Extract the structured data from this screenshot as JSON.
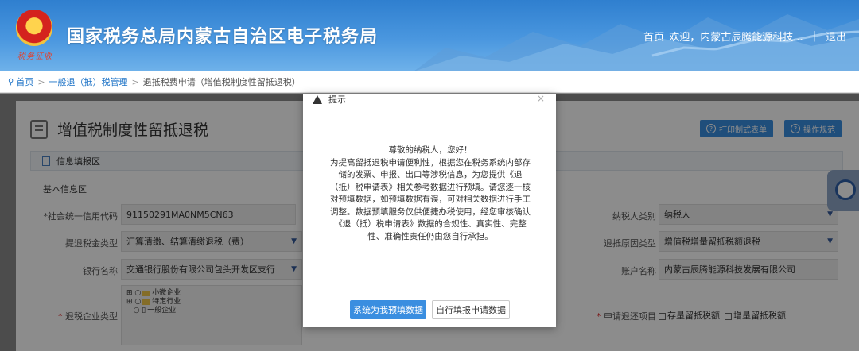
{
  "header": {
    "emblem_script": "税务征收",
    "title": "国家税务总局内蒙古自治区电子税务局",
    "nav": {
      "home": "首页",
      "welcome": "欢迎，内蒙古辰腾能源科技...",
      "separator": "|",
      "logout": "退出"
    }
  },
  "breadcrumb": {
    "home": "首页",
    "level1": "一般退（抵）税管理",
    "current": "退抵税费申请（增值税制度性留抵退税）"
  },
  "page": {
    "title": "增值税制度性留抵退税",
    "btn_print": "打印制式表单",
    "btn_guide": "操作规范",
    "section": "信息填报区",
    "subsection": "基本信息区"
  },
  "form": {
    "credit_code_label": "*社会统一信用代码",
    "credit_code_value": "91150291MA0NM5CN63",
    "taxpayer_type_label": "纳税人类别",
    "taxpayer_type_value": "纳税人",
    "refund_tax_type_label": "提退税金类型",
    "refund_tax_type_value": "汇算清缴、结算清缴退税（费）",
    "refund_reason_label": "退抵原因类型",
    "refund_reason_value": "增值税增量留抵税额退税",
    "bank_label": "银行名称",
    "bank_value": "交通银行股份有限公司包头开发区支行",
    "account_name_label": "账户名称",
    "account_name_value": "内蒙古辰腾能源科技发展有限公司",
    "enterprise_type_label": "退税企业类型",
    "enterprise_type_tree": [
      "小微企业",
      "特定行业",
      "一般企业"
    ],
    "apply_item_label": "申请退还项目",
    "apply_item_opt1": "存量留抵税额",
    "apply_item_opt2": "增量留抵税额"
  },
  "modal": {
    "title": "提示",
    "close": "×",
    "greeting": "尊敬的纳税人，您好！",
    "body": "为提高留抵退税申请便利性，根据您在税务系统内部存储的发票、申报、出口等涉税信息，为您提供《退（抵）税申请表》相关参考数据进行预填。请您逐一核对预填数据，如预填数据有误，可对相关数据进行手工调整。数据预填服务仅供便捷办税使用，经您审核确认《退（抵）税申请表》数据的合规性、真实性、完整性、准确性责任仍由您自行承担。",
    "btn_prefill": "系统为我预填数据",
    "btn_manual": "自行填报申请数据"
  },
  "colors": {
    "header_blue": "#3a8ee0",
    "link": "#1f74c7",
    "required": "#e03030"
  }
}
